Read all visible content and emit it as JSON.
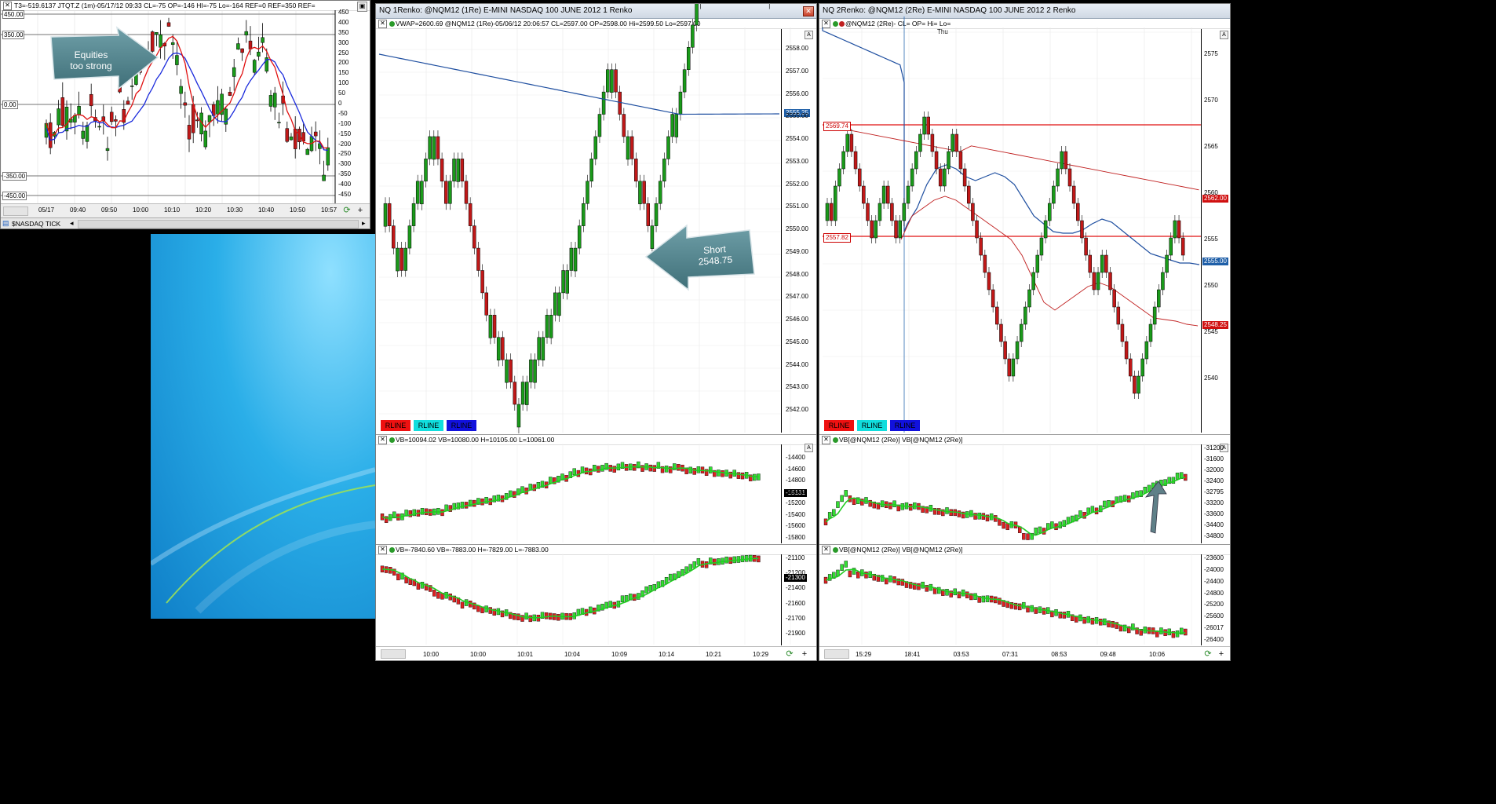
{
  "desktop": {
    "colors": {
      "bg": "#000000",
      "sky": "#1a9ee0"
    }
  },
  "tick_window": {
    "header_text": "T3=-519.6137  JTQT.Z (1m)-05/17/12 09:33 CL=-75 OP=-146 HI=-75 Lo=-164 REF=0 REF=350 REF=",
    "left_labels": [
      "450.00",
      "350.00",
      "0.00",
      "-350.00",
      "-450.00"
    ],
    "y_ticks": [
      "450",
      "400",
      "350",
      "300",
      "250",
      "200",
      "150",
      "100",
      "50",
      "0",
      "-50",
      "-100",
      "-150",
      "-200",
      "-250",
      "-300",
      "-350",
      "-400",
      "-450"
    ],
    "x_ticks": [
      "05/17",
      "09:40",
      "09:50",
      "10:00",
      "10:10",
      "10:20",
      "10:30",
      "10:40",
      "10:50",
      "10:57"
    ],
    "symbol_tab": "$NASDAQ TICK",
    "callout": {
      "line1": "Equities",
      "line2": "too strong"
    }
  },
  "renko1": {
    "title": "NQ 1Renko: @NQM12 (1Re) E-MINI NASDAQ 100 JUNE 2012 1 Renko",
    "header": "VWAP=2600.69  @NQM12 (1Re)-05/06/12 20:06:57 CL=2597.00 OP=2598.00 Hi=2599.50 Lo=2597.00",
    "y_ticks": [
      "2558.00",
      "2557.00",
      "2556.00",
      "2555.00",
      "2554.00",
      "2553.00",
      "2552.00",
      "2551.00",
      "2550.00",
      "2549.00",
      "2548.00",
      "2547.00",
      "2546.00",
      "2545.00",
      "2544.00",
      "2543.00",
      "2542.00"
    ],
    "price_tag": "2555.25",
    "rline_labels": [
      "RLINE",
      "RLINE",
      "RLINE"
    ],
    "callout": {
      "line1": "Short",
      "line2": "2548.75"
    },
    "vb1_header": "VB=10094.02  VB=10080.00 H=10105.00 L=10061.00",
    "vb1_ticks": [
      "-14400",
      "-14600",
      "-14800",
      "-15000",
      "-15200",
      "-15400",
      "-15600",
      "-15800"
    ],
    "vb1_tag": "-15131",
    "vb2_header": "VB=-7840.60  VB=-7883.00 H=-7829.00 L=-7883.00",
    "vb2_ticks": [
      "-21100",
      "-21200",
      "-21400",
      "-21600",
      "-21700",
      "-21900"
    ],
    "vb2_tag": "-21300",
    "x_ticks": [
      "10:00",
      "10:00",
      "10:01",
      "10:04",
      "10:09",
      "10:14",
      "10:21",
      "10:29"
    ]
  },
  "renko2": {
    "title": "NQ 2Renko: @NQM12 (2Re) E-MINI NASDAQ 100 JUNE 2012 2 Renko",
    "header": "@NQM12 (2Re)- CL= OP= Hi= Lo=",
    "thu_label": "Thu",
    "y_ticks": [
      "2575",
      "2570",
      "2565",
      "2560",
      "2555",
      "2550",
      "2545",
      "2540"
    ],
    "level_high": "2569.74",
    "level_low": "2557.82",
    "tag_red": "2562.00",
    "tag_blue": "2555.00",
    "tag_red2": "2548.25",
    "rline_labels": [
      "RLINE",
      "RLINE",
      "RLINE"
    ],
    "vb1_header": "VB[@NQM12 (2Re)]  VB[@NQM12 (2Re)]",
    "vb1_ticks": [
      "-31200",
      "-31600",
      "-32000",
      "-32400",
      "-32795",
      "-33200",
      "-33600",
      "-34400",
      "-34800"
    ],
    "vb2_header": "VB[@NQM12 (2Re)]  VB[@NQM12 (2Re)]",
    "vb2_ticks": [
      "-23600",
      "-24000",
      "-24400",
      "-24800",
      "-25200",
      "-25600",
      "-26017",
      "-26400"
    ],
    "x_ticks": [
      "15:29",
      "18:41",
      "03:53",
      "07:31",
      "08:53",
      "09:48",
      "10:06"
    ]
  }
}
